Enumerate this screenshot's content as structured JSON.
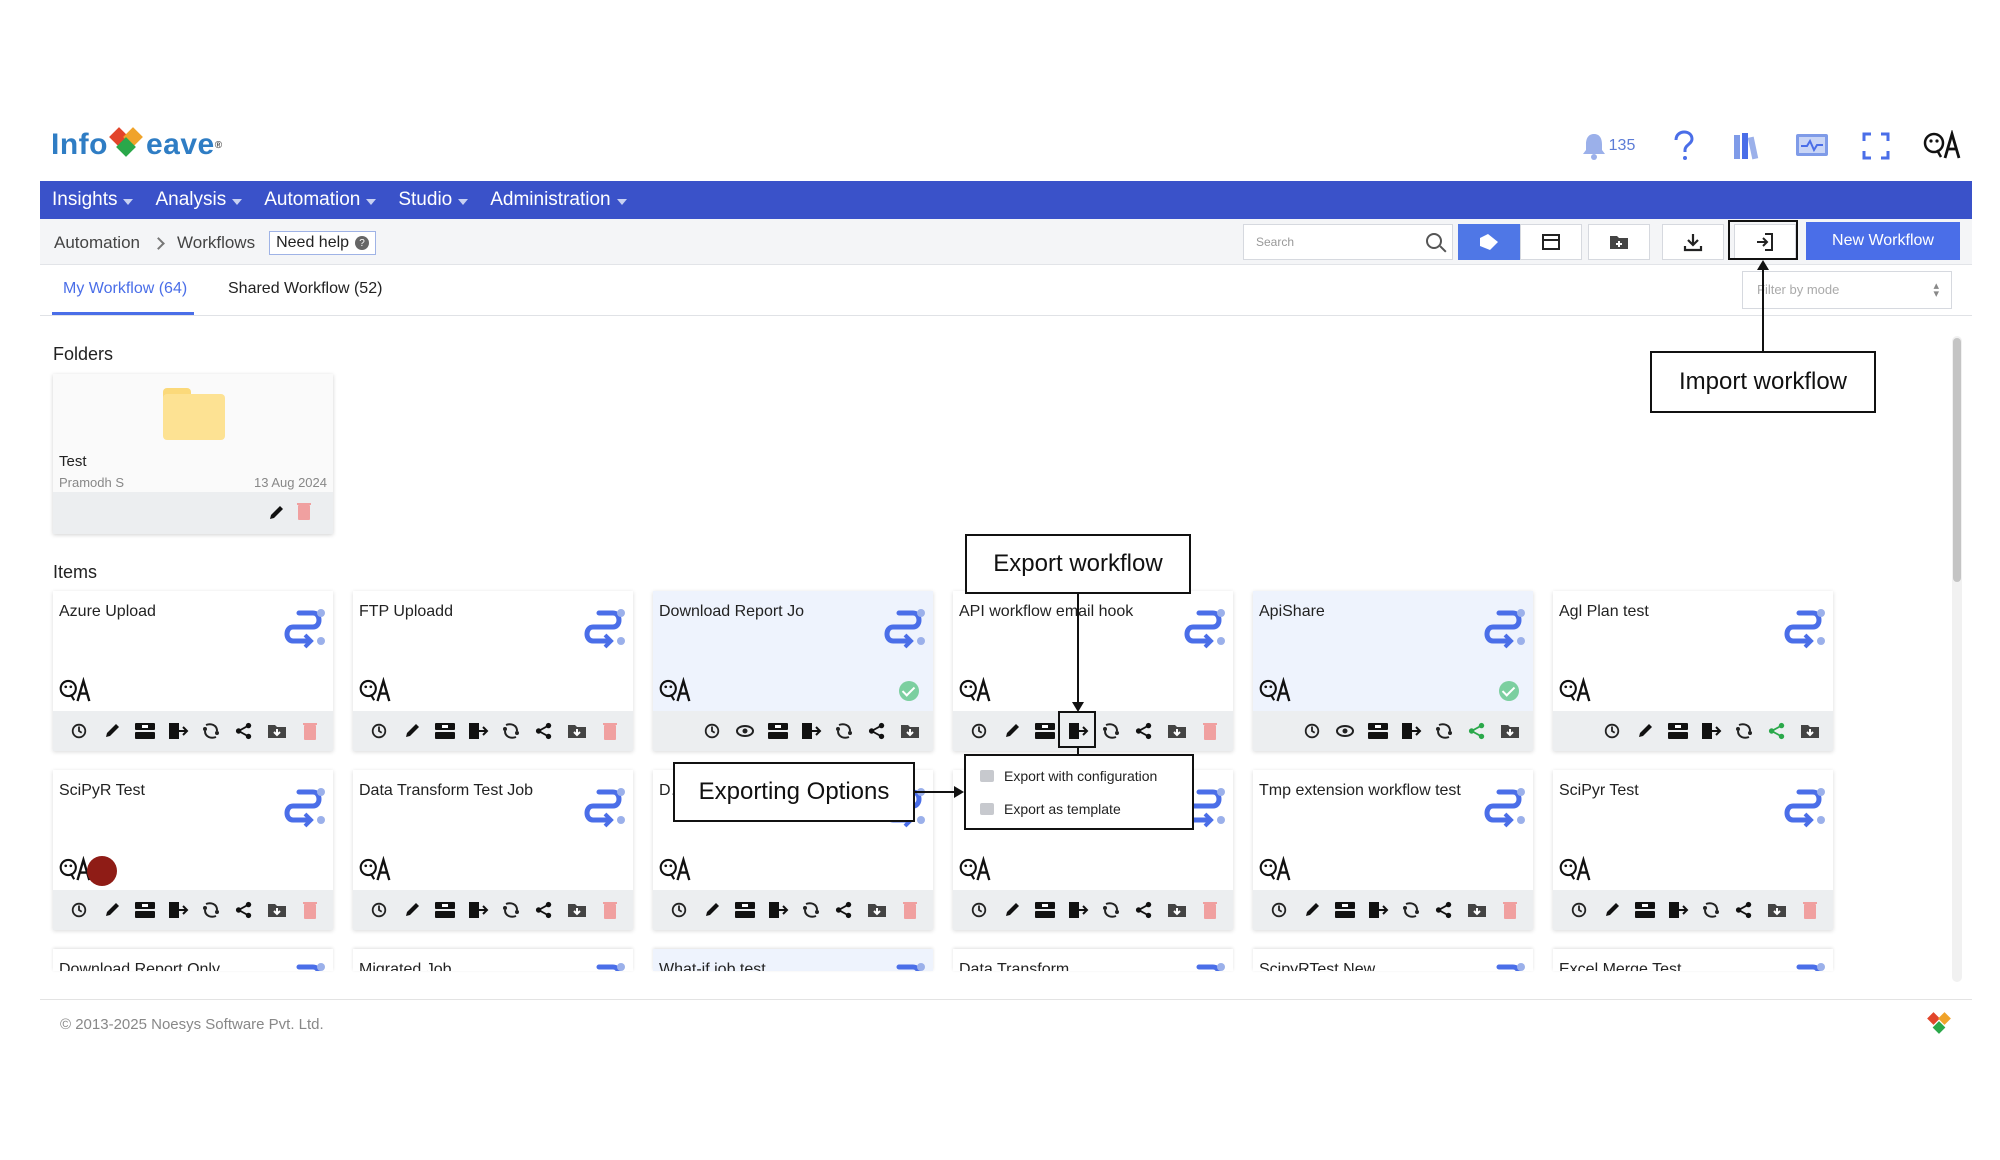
{
  "header": {
    "logo_text_left": "Info",
    "logo_text_right": "eave",
    "notification_count": "135",
    "user_initials": "QA"
  },
  "nav": [
    {
      "label": "Insights"
    },
    {
      "label": "Analysis"
    },
    {
      "label": "Automation"
    },
    {
      "label": "Studio"
    },
    {
      "label": "Administration"
    }
  ],
  "breadcrumb": {
    "items": [
      "Automation",
      "Workflows"
    ],
    "need_help": "Need help",
    "help_mark": "?"
  },
  "toolbar": {
    "search_placeholder": "Search",
    "new_workflow": "New Workflow"
  },
  "tabs": [
    {
      "label": "My Workflow (64)",
      "active": true
    },
    {
      "label": "Shared Workflow (52)",
      "active": false
    }
  ],
  "filter": {
    "placeholder": "Filter by mode"
  },
  "sections": {
    "folders": "Folders",
    "items": "Items"
  },
  "folders": [
    {
      "name": "Test",
      "owner": "Pramodh S",
      "date": "13 Aug 2024"
    }
  ],
  "items": [
    {
      "title": "Azure Upload",
      "highlight": false,
      "check": false
    },
    {
      "title": "FTP Uploadd",
      "highlight": false,
      "check": false
    },
    {
      "title": "Download Report Jo",
      "highlight": true,
      "check": true
    },
    {
      "title": "API workflow email hook",
      "highlight": false,
      "check": false
    },
    {
      "title": "ApiShare",
      "highlight": true,
      "check": true
    },
    {
      "title": "Agl Plan test",
      "highlight": false,
      "check": false
    },
    {
      "title": "SciPyR Test",
      "highlight": false,
      "check": false
    },
    {
      "title": "Data Transform Test Job",
      "highlight": false,
      "check": false
    },
    {
      "title": "D… Jo…",
      "highlight": false,
      "check": false
    },
    {
      "title": "",
      "highlight": false,
      "check": false
    },
    {
      "title": "Tmp extension workflow test",
      "highlight": false,
      "check": false
    },
    {
      "title": "SciPyr Test",
      "highlight": false,
      "check": false
    },
    {
      "title": "Download Report Only",
      "highlight": false,
      "check": false
    },
    {
      "title": "Migrated Job",
      "highlight": false,
      "check": false
    },
    {
      "title": "What-if job test",
      "highlight": true,
      "check": false
    },
    {
      "title": "Data Transform",
      "highlight": false,
      "check": false
    },
    {
      "title": "ScipyRTest New",
      "highlight": false,
      "check": false
    },
    {
      "title": "Excel Merge Test",
      "highlight": false,
      "check": false
    }
  ],
  "export_menu": {
    "items": [
      "Export with configuration",
      "Export as template"
    ]
  },
  "annotations": {
    "import": "Import workflow",
    "export": "Export workflow",
    "options": "Exporting Options"
  },
  "footer": {
    "copyright": "© 2013-2025 Noesys Software Pvt. Ltd."
  },
  "colors": {
    "nav": "#3a52c9",
    "accent": "#4a6ee8",
    "flow_icon": "#4a6ee8",
    "delete": "#f0a0a0",
    "share_green": "#2aa84a"
  }
}
